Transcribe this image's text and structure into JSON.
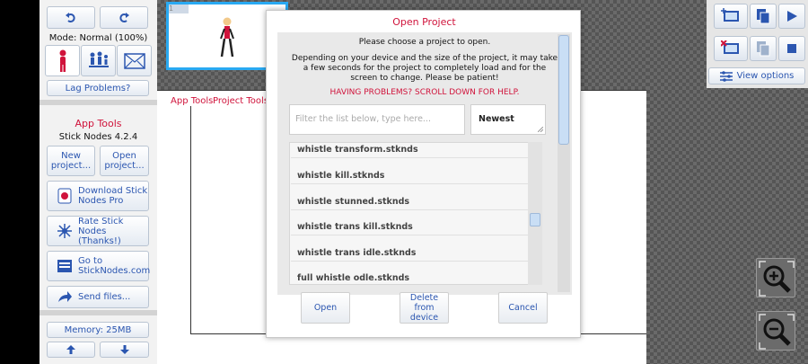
{
  "left_panel": {
    "mode_label": "Mode: Normal (100%)",
    "lag_button": "Lag Problems?",
    "app_tools_header": "App Tools",
    "version": "Stick Nodes 4.2.4",
    "new_project": "New project...",
    "open_project": "Open project...",
    "download_pro": "Download Stick Nodes Pro",
    "rate": "Rate Stick Nodes (Thanks!)",
    "goto": "Go to StickNodes.com",
    "send_files": "Send files...",
    "memory": "Memory: 25MB"
  },
  "canvas": {
    "frame_number": "1",
    "tab_app_tools": "App Tools",
    "tab_project_tools": "Project Tools"
  },
  "right_panel": {
    "view_options": "View options"
  },
  "modal": {
    "title": "Open Project",
    "prompt": "Please choose a project to open.",
    "info": "Depending on your device and the size of the project, it may take a few seconds for the project to completely load and for the screen to change. Please be patient!",
    "help": "HAVING PROBLEMS? SCROLL DOWN FOR HELP.",
    "filter_placeholder": "Filter the list below, type here...",
    "sort_value": "Newest",
    "files": [
      "whistle transform.stknds",
      "whistle kill.stknds",
      "whistle stunned.stknds",
      "whistle trans kill.stknds",
      "whistle trans idle.stknds",
      "full whistle odle.stknds"
    ],
    "open_button": "Open",
    "delete_button": "Delete from device",
    "cancel_button": "Cancel"
  },
  "colors": {
    "accent_red": "#d0133b",
    "button_blue": "#2b56b0",
    "frame_border": "#29a9f2"
  }
}
